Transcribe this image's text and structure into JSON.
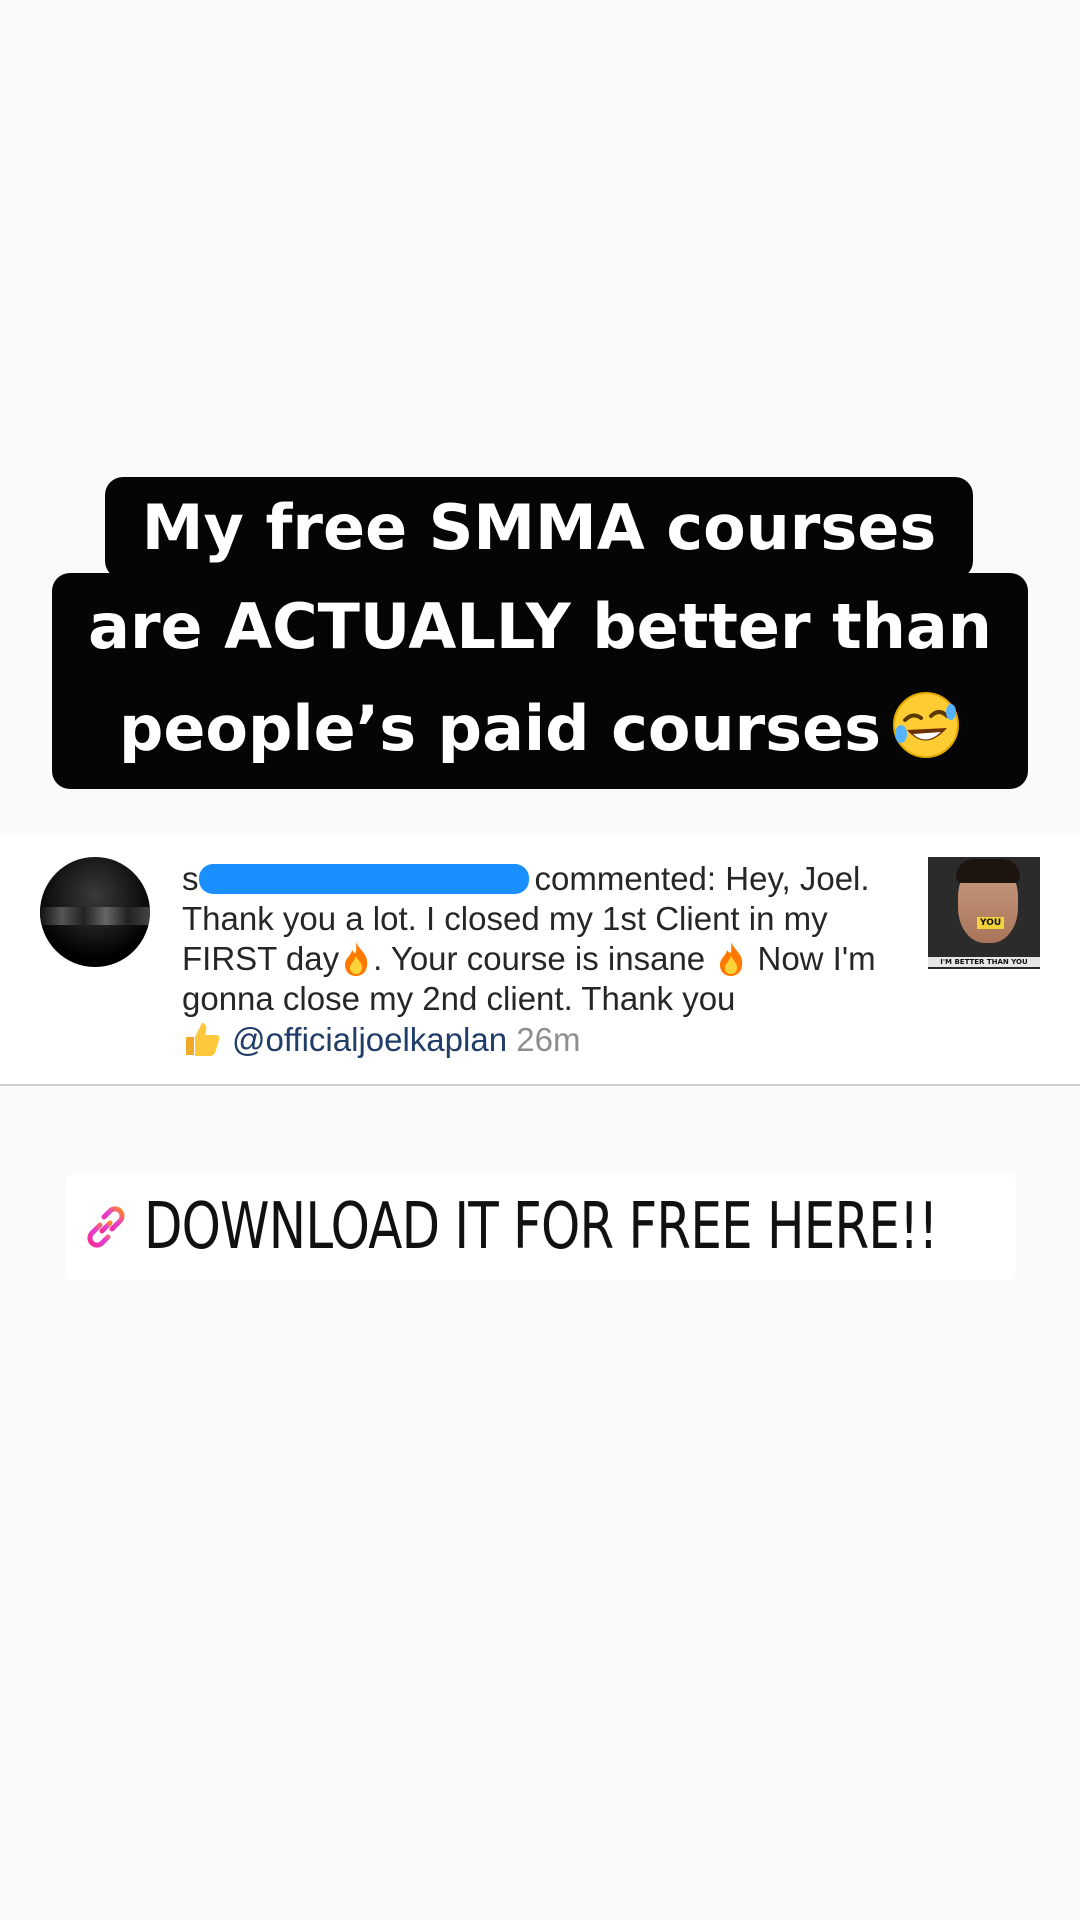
{
  "headline": {
    "line1": "My free SMMA courses",
    "line2": "are ACTUALLY better than",
    "line3": "people’s paid courses",
    "emoji": "rolling-on-floor-laughing"
  },
  "comment_card": {
    "username_initial": "s",
    "action": "commented:",
    "text_part1": " Hey, Joel. Thank you a lot. I closed my 1st Client in my FIRST day",
    "text_part2": ". Your course is insane ",
    "text_part3": " Now I'm gonna close my 2nd client. Thank you ",
    "mention": "@officialjoelkaplan",
    "time": "26m",
    "thumbnail": {
      "badge": "YOU",
      "caption": "I'M BETTER THAN YOU"
    }
  },
  "download": {
    "label": "DOWNLOAD IT FOR FREE HERE!!"
  },
  "colors": {
    "background": "#fafafa",
    "caption_bg": "#050505",
    "redaction": "#1a8fff",
    "mention": "#1f3d68"
  }
}
